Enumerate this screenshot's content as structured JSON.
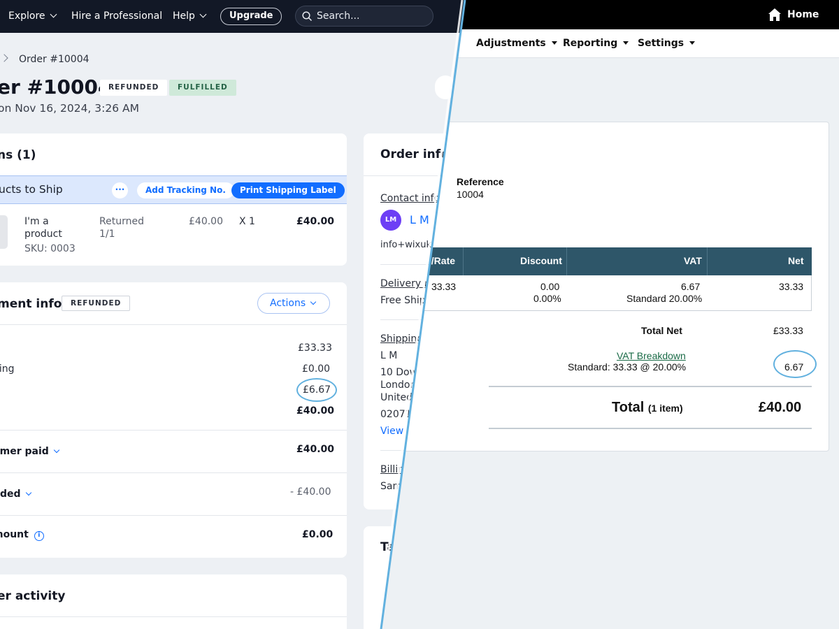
{
  "left": {
    "nav": {
      "explore": "Explore",
      "hire": "Hire a Professional",
      "help": "Help",
      "upgrade": "Upgrade",
      "search_placeholder": "Search..."
    },
    "breadcrumb": "Order #10004",
    "order_title": "er #10004",
    "badges": {
      "refunded": "REFUNDED",
      "fulfilled": "FULFILLED"
    },
    "order_date": "on Nov 16, 2024, 3:26 AM",
    "items_card": {
      "title": "ns (1)",
      "ship_bar_title": "ucts to Ship",
      "dots": "···",
      "add_tracking": "Add Tracking No.",
      "print_label": "Print Shipping Label",
      "product": {
        "name_line1": "I'm a",
        "name_line2": "product",
        "sku": "SKU: 0003",
        "status_line1": "Returned",
        "status_line2": "1/1",
        "price": "£40.00",
        "qty": "X 1",
        "total": "£40.00"
      }
    },
    "payment_card": {
      "title": "ment info",
      "badge": "REFUNDED",
      "actions": "Actions",
      "subtotal": "£33.33",
      "shipping_label": "ping",
      "shipping": "£0.00",
      "tax": "£6.67",
      "total": "£40.00",
      "customer_paid_label": "omer paid",
      "customer_paid": "£40.00",
      "refunded_label": "nded",
      "refunded": "- £40.00",
      "amount_label": "mount",
      "amount": "£0.00",
      "info_icon": "i"
    },
    "activity_card": {
      "title": "er activity"
    },
    "order_info_card": {
      "title": "Order info",
      "contact_label": "Contact info",
      "avatar": "LM",
      "contact_name": "L M",
      "email": "info+wixuk",
      "delivery_label": "Delivery m",
      "delivery_value": "Free Ship",
      "shipping_label": "Shipping",
      "ship_name": "L M",
      "ship_line1": "10 Dow",
      "ship_line2": "London",
      "ship_line3": "United",
      "ship_phone": "02071",
      "view": "View",
      "billing_label": "Billin",
      "billing_value": "Sam"
    },
    "tags_card": {
      "title": "Ta"
    }
  },
  "right": {
    "home": "Home",
    "menu": {
      "adjustments": "Adjustments",
      "reporting": "Reporting",
      "settings": "Settings"
    },
    "invoice": {
      "reference_label": "Reference",
      "reference_value": "10004",
      "headers": {
        "rate": "y/Rate",
        "discount": "Discount",
        "vat": "VAT",
        "net": "Net"
      },
      "row": {
        "rate": "33.33",
        "discount": "0.00",
        "discount_pct": "0.00%",
        "vat": "6.67",
        "vat_rate": "Standard 20.00%",
        "net": "33.33"
      },
      "total_net_label": "Total Net",
      "total_net": "£33.33",
      "vat_breakdown": "VAT Breakdown",
      "vat_standard": "Standard: 33.33 @ 20.00%",
      "vat_value": "6.67",
      "total_label": "Total",
      "total_items": "(1 item)",
      "total": "£40.00"
    }
  },
  "colors": {
    "accent_blue": "#116dff",
    "header_teal": "#2e5669",
    "highlight_circle": "#62b1df",
    "topbar_dark": "#121826"
  }
}
